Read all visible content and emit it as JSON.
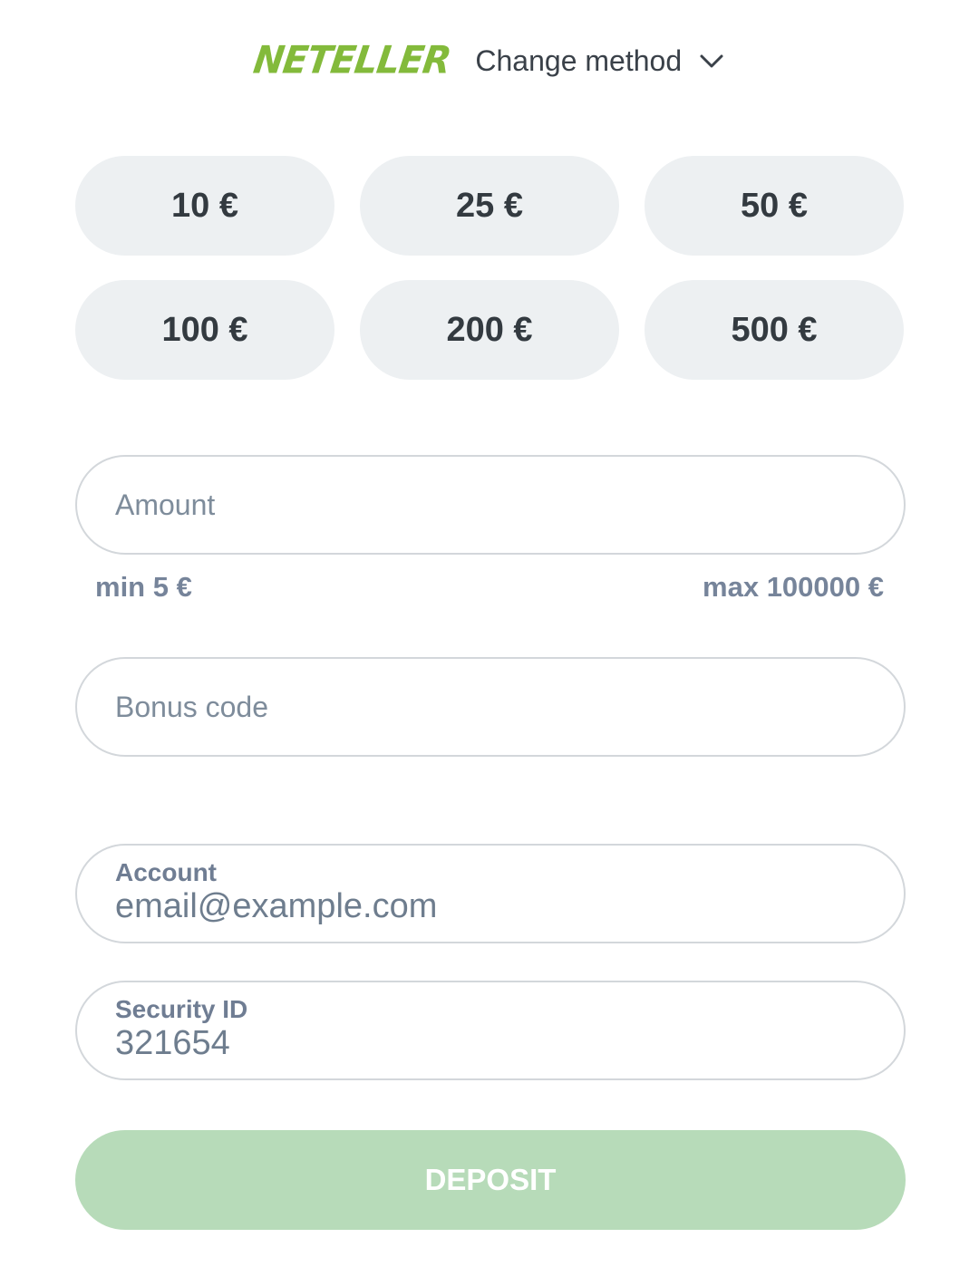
{
  "header": {
    "logo_text": "NETELLER",
    "change_method_label": "Change method",
    "chevron_icon": "chevron-down-icon"
  },
  "presets": [
    {
      "label": "10 €"
    },
    {
      "label": "25 €"
    },
    {
      "label": "50 €"
    },
    {
      "label": "100 €"
    },
    {
      "label": "200 €"
    },
    {
      "label": "500 €"
    }
  ],
  "amount": {
    "placeholder": "Amount",
    "value": "",
    "min_label": "min 5 €",
    "max_label": "max 100000 €"
  },
  "bonus": {
    "placeholder": "Bonus code",
    "value": ""
  },
  "account": {
    "label": "Account",
    "value": "email@example.com"
  },
  "security": {
    "label": "Security ID",
    "value": "321654"
  },
  "deposit": {
    "label": "DEPOSIT"
  },
  "colors": {
    "brand": "#83ba3b",
    "deposit_button": "#b7dbb9",
    "preset_bg": "#edf0f2",
    "muted_text": "#76849a"
  }
}
